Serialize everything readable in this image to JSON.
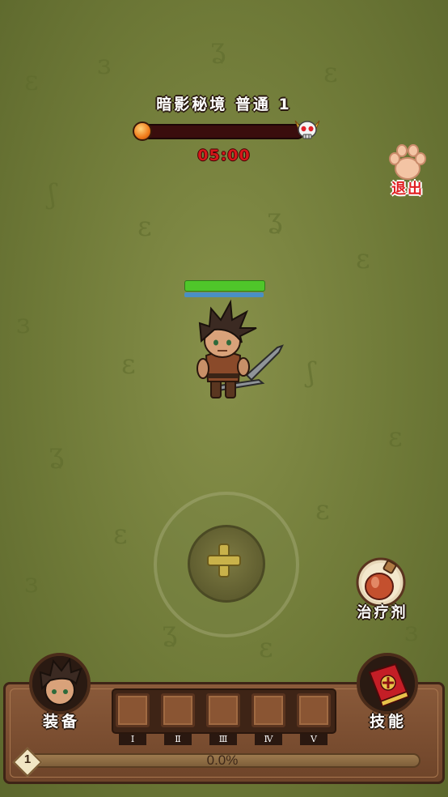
{
  "stage": {
    "title": "暗影秘境 普通 1",
    "timer": "05:00",
    "wave_progress": 0.0
  },
  "exit": {
    "label": "退出"
  },
  "player": {
    "hp_fraction": 1.0,
    "mp_fraction": 1.0
  },
  "potion": {
    "label": "治疗剂"
  },
  "bottom": {
    "equipment_label": "装备",
    "skill_label": "技能",
    "slots": [
      "Ⅰ",
      "Ⅱ",
      "Ⅲ",
      "Ⅳ",
      "Ⅴ"
    ],
    "level": "1",
    "exp_text": "0.0%"
  },
  "colors": {
    "timer": "#d6161a",
    "exit": "#e01f22",
    "hp": "#4fc62a",
    "mp": "#4a8fc4"
  },
  "icons": [
    "paw-icon",
    "boss-skull-icon",
    "orb-icon",
    "plus-icon",
    "potion-icon",
    "skill-book-icon",
    "hero-avatar"
  ]
}
